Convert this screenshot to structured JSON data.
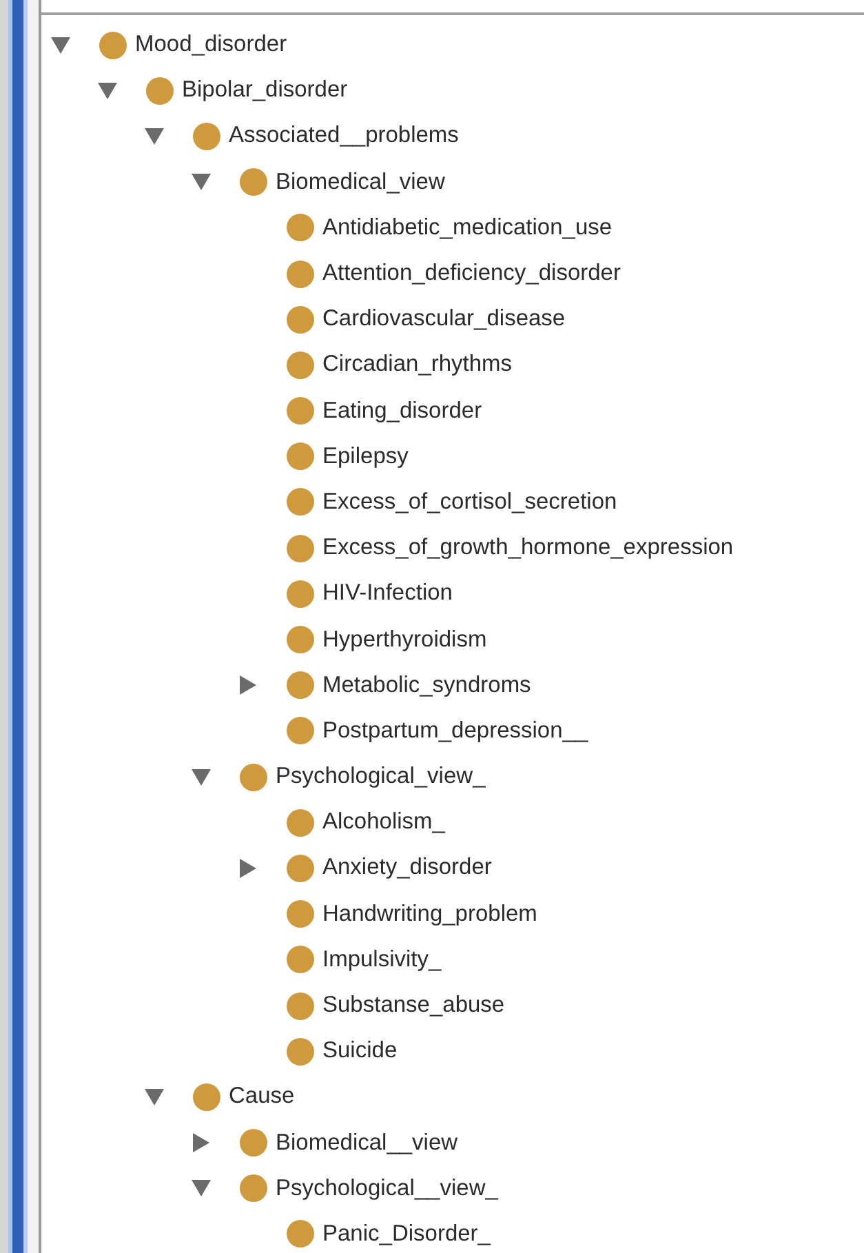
{
  "tree": [
    {
      "label": "Mood_disorder",
      "expanded": true,
      "children": [
        {
          "label": "Bipolar_disorder",
          "expanded": true,
          "children": [
            {
              "label": "Associated__problems",
              "expanded": true,
              "children": [
                {
                  "label": "Biomedical_view",
                  "expanded": true,
                  "children": [
                    {
                      "label": "Antidiabetic_medication_use"
                    },
                    {
                      "label": "Attention_deficiency_disorder"
                    },
                    {
                      "label": "Cardiovascular_disease"
                    },
                    {
                      "label": "Circadian_rhythms"
                    },
                    {
                      "label": "Eating_disorder"
                    },
                    {
                      "label": "Epilepsy"
                    },
                    {
                      "label": "Excess_of_cortisol_secretion"
                    },
                    {
                      "label": "Excess_of_growth_hormone_expression"
                    },
                    {
                      "label": "HIV-Infection"
                    },
                    {
                      "label": "Hyperthyroidism"
                    },
                    {
                      "label": "Metabolic_syndroms",
                      "expanded": false
                    },
                    {
                      "label": "Postpartum_depression__"
                    }
                  ]
                },
                {
                  "label": "Psychological_view_",
                  "expanded": true,
                  "children": [
                    {
                      "label": "Alcoholism_"
                    },
                    {
                      "label": "Anxiety_disorder",
                      "expanded": false
                    },
                    {
                      "label": "Handwriting_problem"
                    },
                    {
                      "label": "Impulsivity_"
                    },
                    {
                      "label": "Substanse_abuse"
                    },
                    {
                      "label": "Suicide"
                    }
                  ]
                }
              ]
            },
            {
              "label": "Cause",
              "expanded": true,
              "children": [
                {
                  "label": "Biomedical__view",
                  "expanded": false
                },
                {
                  "label": "Psychological__view_",
                  "expanded": true,
                  "children": [
                    {
                      "label": "Panic_Disorder_"
                    }
                  ]
                }
              ]
            }
          ]
        }
      ]
    }
  ]
}
